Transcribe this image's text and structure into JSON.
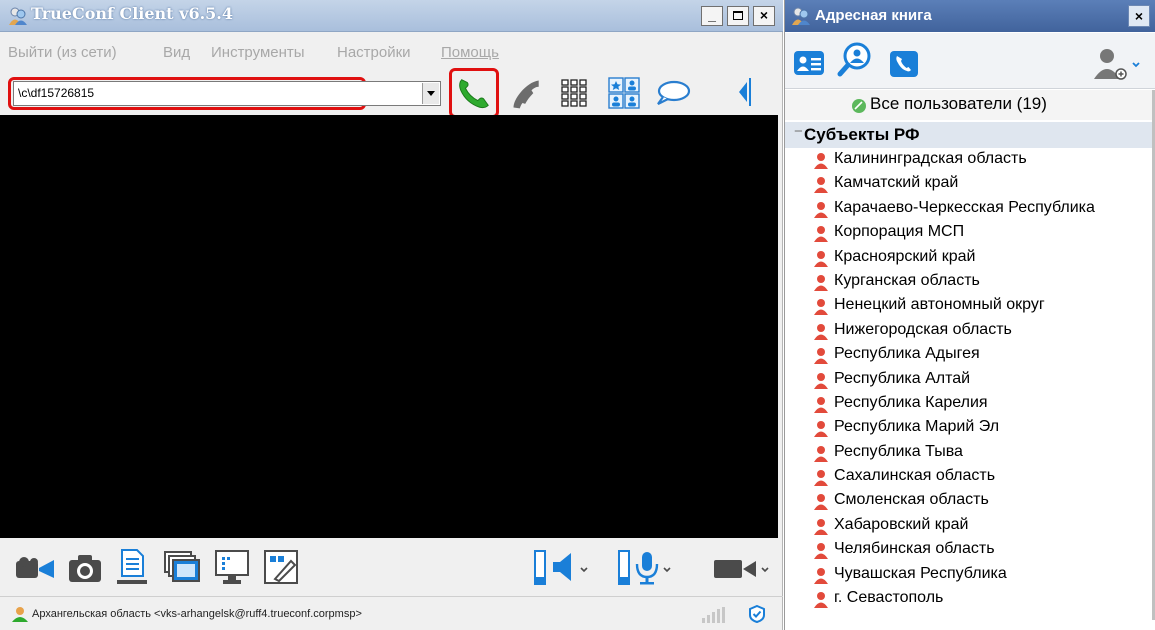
{
  "main_window": {
    "title": "TrueConf Client v6.5.4",
    "menu": [
      "Выйти (из сети)",
      "Вид",
      "Инструменты",
      "Настройки",
      "Помощь"
    ],
    "destination_value": "\\c\\df15726815",
    "window_buttons": {
      "minimize": "_",
      "maximize": "□",
      "close": "×"
    },
    "status": {
      "user_text": "Архангельская область <vks-arhangelsk@ruff4.trueconf.corpmsp>"
    }
  },
  "address_book": {
    "title": "Адресная книга",
    "close_label": "×",
    "all_users": "Все пользователи (19)",
    "group": "Субъекты РФ",
    "contacts": [
      "Калининградская область",
      "Камчатский край",
      "Карачаево-Черкесская Республика",
      "Корпорация МСП",
      "Красноярский край",
      "Курганская область",
      "Ненецкий автономный округ",
      "Нижегородская область",
      "Республика Адыгея",
      "Республика Алтай",
      "Республика Карелия",
      "Республика Марий Эл",
      "Республика Тыва",
      "Сахалинская область",
      "Смоленская область",
      "Хабаровский край",
      "Челябинская область",
      "Чувашская Республика",
      "г. Севастополь"
    ]
  },
  "colors": {
    "highlight": "#e01010",
    "call_green": "#2eaa2e",
    "accent_blue": "#1a7fd8",
    "contact_icon": "#e24a3b",
    "video_bg": "#000000"
  },
  "icons": {
    "toolbar": [
      "call-icon",
      "hangup-icon",
      "dialpad-icon",
      "layout-icon",
      "chat-icon",
      "collapse-arrow-icon"
    ],
    "bottom": [
      "video-camera-icon",
      "photo-camera-icon",
      "file-send-icon",
      "slides-icon",
      "screen-share-icon",
      "whiteboard-icon",
      "speaker-icon",
      "microphone-icon",
      "camera-toggle-icon"
    ],
    "address_book": [
      "contacts-icon",
      "search-icon",
      "call-history-icon",
      "add-user-icon"
    ]
  }
}
